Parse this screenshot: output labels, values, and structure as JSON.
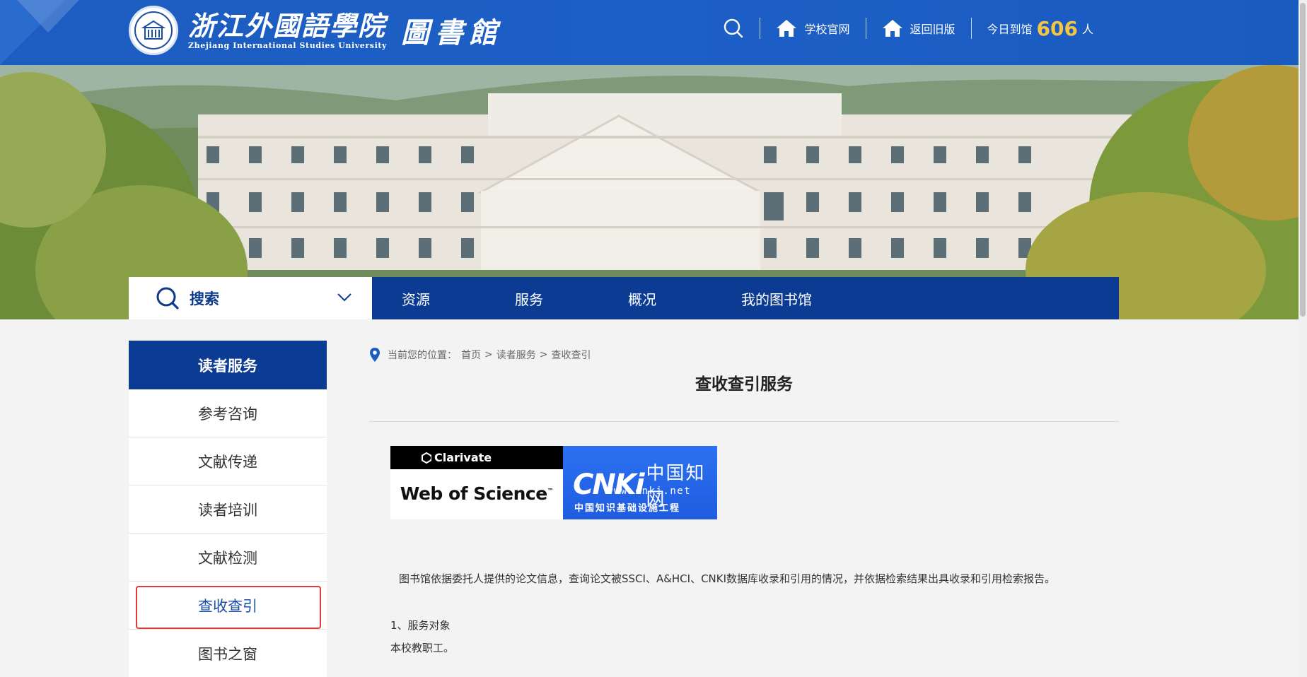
{
  "header": {
    "school_name_cn": "浙江外國語學院",
    "school_name_en": "Zhejiang International Studies University",
    "library_title": "圖書館",
    "links": [
      {
        "label": "学校官网"
      },
      {
        "label": "返回旧版"
      }
    ],
    "visit_prefix": "今日到馆",
    "visit_count": "606",
    "visit_suffix": "人",
    "search_icon": "search-icon",
    "home_icon": "home-icon"
  },
  "nav": {
    "search_label": "搜索",
    "items": [
      "资源",
      "服务",
      "概况",
      "我的图书馆"
    ]
  },
  "sidebar": {
    "title": "读者服务",
    "items": [
      {
        "label": "参考咨询"
      },
      {
        "label": "文献传递"
      },
      {
        "label": "读者培训"
      },
      {
        "label": "文献检测"
      },
      {
        "label": "查收查引"
      },
      {
        "label": "图书之窗"
      }
    ],
    "active_index": 4
  },
  "breadcrumb": {
    "prefix": "当前您的位置：",
    "items": [
      "首页",
      "读者服务",
      "查收查引"
    ],
    "separator": ">"
  },
  "main": {
    "title": "查收查引服务",
    "banner": {
      "wos_brand": "Clarivate",
      "wos_name": "Web of Science",
      "wos_tm": "™",
      "cnki_logo": "CNKi",
      "cnki_cn": "中国知网",
      "cnki_url": "www.cnki.net",
      "cnki_sub": "中国知识基础设施工程"
    },
    "intro": "图书馆依据委托人提供的论文信息，查询论文被SSCI、A&HCI、CNKI数据库收录和引用的情况，并依据检索结果出具收录和引用检索报告。",
    "section1_title": "1、服务对象",
    "section1_body": "本校教职工。"
  },
  "colors": {
    "header_blue": "#1d5cc0",
    "nav_blue": "#0c3b93",
    "accent_gold": "#f5c542",
    "active_outline": "#e23a3a"
  }
}
